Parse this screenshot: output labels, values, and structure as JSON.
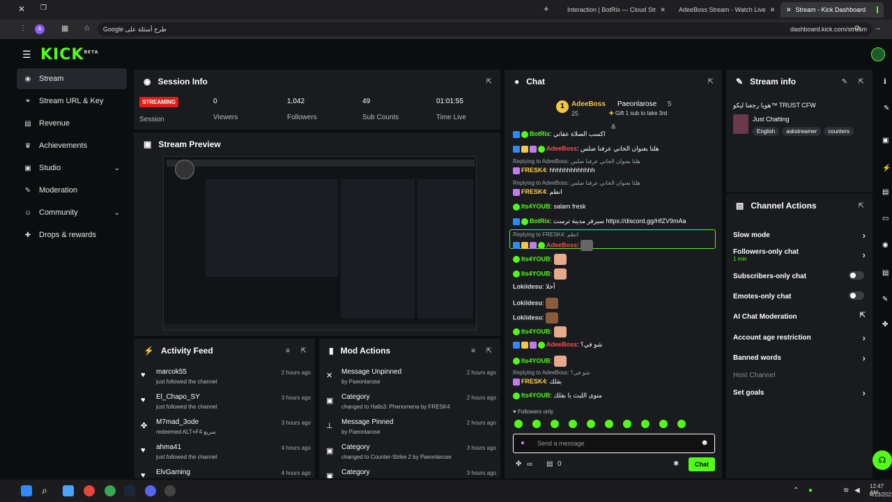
{
  "browser": {
    "tabs": [
      {
        "label": "Interaction | BotRix — Cloud Str"
      },
      {
        "label": "AdeeBoss Stream - Watch Live"
      },
      {
        "label": "Stream - Kick Dashboard"
      }
    ],
    "search_placeholder": "Google طرح أسئلة على",
    "url": "dashboard.kick.com/stream",
    "profile_letter": "A"
  },
  "logo": {
    "text": "KICK",
    "badge": "BETA"
  },
  "sidebar": {
    "items": [
      {
        "label": "Stream",
        "icon": "broadcast-icon"
      },
      {
        "label": "Stream URL & Key",
        "icon": "link-icon"
      },
      {
        "label": "Revenue",
        "icon": "chart-icon"
      },
      {
        "label": "Achievements",
        "icon": "trophy-icon"
      },
      {
        "label": "Studio",
        "icon": "studio-icon"
      },
      {
        "label": "Moderation",
        "icon": "wrench-icon"
      },
      {
        "label": "Community",
        "icon": "people-icon"
      },
      {
        "label": "Drops & rewards",
        "icon": "gift-icon"
      }
    ]
  },
  "session": {
    "title": "Session Info",
    "status": "STREAMING",
    "status_label": "Session",
    "viewers": "0",
    "viewers_label": "Viewers",
    "followers": "1,042",
    "followers_label": "Followers",
    "subs": "49",
    "subs_label": "Sub Counts",
    "time": "01:01:55",
    "time_label": "Time Live"
  },
  "preview": {
    "title": "Stream Preview"
  },
  "activity": {
    "title": "Activity Feed",
    "rows": [
      {
        "name": "marcok55",
        "sub": "just followed the channel",
        "time": "2 hours ago"
      },
      {
        "name": "El_Chapo_SY",
        "sub": "just followed the channel",
        "time": "3 hours ago"
      },
      {
        "name": "M7mad_3ode",
        "sub": "redeemed ALT+F4 سريع",
        "time": "3 hours ago"
      },
      {
        "name": "ahma41",
        "sub": "just followed the channel",
        "time": "4 hours ago"
      },
      {
        "name": "ElvGaming",
        "sub": "",
        "time": "4 hours ago"
      }
    ]
  },
  "mod": {
    "title": "Mod Actions",
    "rows": [
      {
        "name": "Message Unpinned",
        "sub": "by Paeonlarose",
        "time": "2 hours ago"
      },
      {
        "name": "Category",
        "sub": "changed to Halls3: Phenomena by FRESK4",
        "time": "2 hours ago"
      },
      {
        "name": "Message Pinned",
        "sub": "by Paeonlarose",
        "time": "2 hours ago"
      },
      {
        "name": "Category",
        "sub": "changed to Counter-Strike 2 by Paeonlarose",
        "time": "3 hours ago"
      },
      {
        "name": "Category",
        "sub": "",
        "time": "3 hours ago"
      }
    ]
  },
  "chat": {
    "title": "Chat",
    "pinned": {
      "user1": "AdeeBoss",
      "count1": "25",
      "user2": "Paeonlarose",
      "count2": "5",
      "gift": "Gift 1 sub to take 3rd",
      "rank": "1"
    },
    "messages": [
      {
        "user": "BotRix",
        "text": "اكسب الصلاة عقاتي",
        "color": "g",
        "reply": ""
      },
      {
        "user": "AdeeBoss",
        "text": "هلتا بعنوان الخاني عرفنا ضلس",
        "color": "r",
        "reply": ""
      },
      {
        "user": "FRESK4",
        "text": "hhhhhhhhhhhhh",
        "color": "y",
        "reply": "Replying to AdeeBoss: هلتا بعنوان الخاني عرفنا ضلس"
      },
      {
        "user": "FRESK4",
        "text": "انطم",
        "color": "y",
        "reply": "Replying to AdeeBoss: هلتا بعنوان الخاني عرفنا ضلس"
      },
      {
        "user": "Its4YOUB",
        "text": "salam fresk",
        "color": "g",
        "reply": ""
      },
      {
        "user": "BotRix",
        "text": "سيرفر مدينة ترست https://discord.gg/HfZV9mAa",
        "color": "g",
        "reply": ""
      },
      {
        "user": "AdeeBoss",
        "text": "",
        "color": "r",
        "reply": "Replying to FRESK4: انطم"
      },
      {
        "user": "Its4YOUB",
        "text": "",
        "color": "g",
        "reply": ""
      },
      {
        "user": "Its4YOUB",
        "text": "",
        "color": "g",
        "reply": ""
      },
      {
        "user": "Lokiidesu",
        "text": "أخلا",
        "color": "w",
        "reply": ""
      },
      {
        "user": "Lokiidesu",
        "text": "",
        "color": "w",
        "reply": ""
      },
      {
        "user": "Lokiidesu",
        "text": "",
        "color": "w",
        "reply": ""
      },
      {
        "user": "Its4YOUB",
        "text": "",
        "color": "g",
        "reply": ""
      },
      {
        "user": "AdeeBoss",
        "text": "شو في؟",
        "color": "r",
        "reply": ""
      },
      {
        "user": "Its4YOUB",
        "text": "",
        "color": "g",
        "reply": ""
      },
      {
        "user": "FRESK4",
        "text": "بقلك",
        "color": "y",
        "reply": "Replying to AdeeBoss: شو في؟"
      },
      {
        "user": "Its4YOUB",
        "text": "متوى الليث يا بقلك",
        "color": "g",
        "reply": ""
      }
    ],
    "followers_only": "Followers only",
    "input_placeholder": "Send a message",
    "infinity": "∞",
    "count": "0",
    "send_label": "Chat"
  },
  "stream_info": {
    "title": "Stream info",
    "stream_title": "هويا رجعنا ليكو™ TRUST CFW",
    "category": "Just Chatting",
    "tags": [
      "English",
      "askstreamer",
      "counters"
    ]
  },
  "channel_actions": {
    "title": "Channel Actions",
    "items": [
      {
        "label": "Slow mode",
        "sub": "",
        "control": "arrow"
      },
      {
        "label": "Followers-only chat",
        "sub": "1 min",
        "control": "arrow"
      },
      {
        "label": "Subscribers-only chat",
        "sub": "",
        "control": "toggle"
      },
      {
        "label": "Emotes-only chat",
        "sub": "",
        "control": "toggle"
      },
      {
        "label": "AI Chat Moderation",
        "sub": "",
        "control": "external"
      },
      {
        "label": "Account age restriction",
        "sub": "",
        "control": "arrow"
      },
      {
        "label": "Banned words",
        "sub": "",
        "control": "arrow"
      },
      {
        "label": "Host Channel",
        "sub": "",
        "control": "none"
      },
      {
        "label": "Set goals",
        "sub": "",
        "control": "arrow"
      }
    ]
  },
  "taskbar": {
    "time": "12:47 AM",
    "date": "4/13/202"
  },
  "colors": {
    "brand": "#53fc18",
    "bg": "#0b0e0f",
    "panel": "#191b1f",
    "live": "#e91916"
  }
}
